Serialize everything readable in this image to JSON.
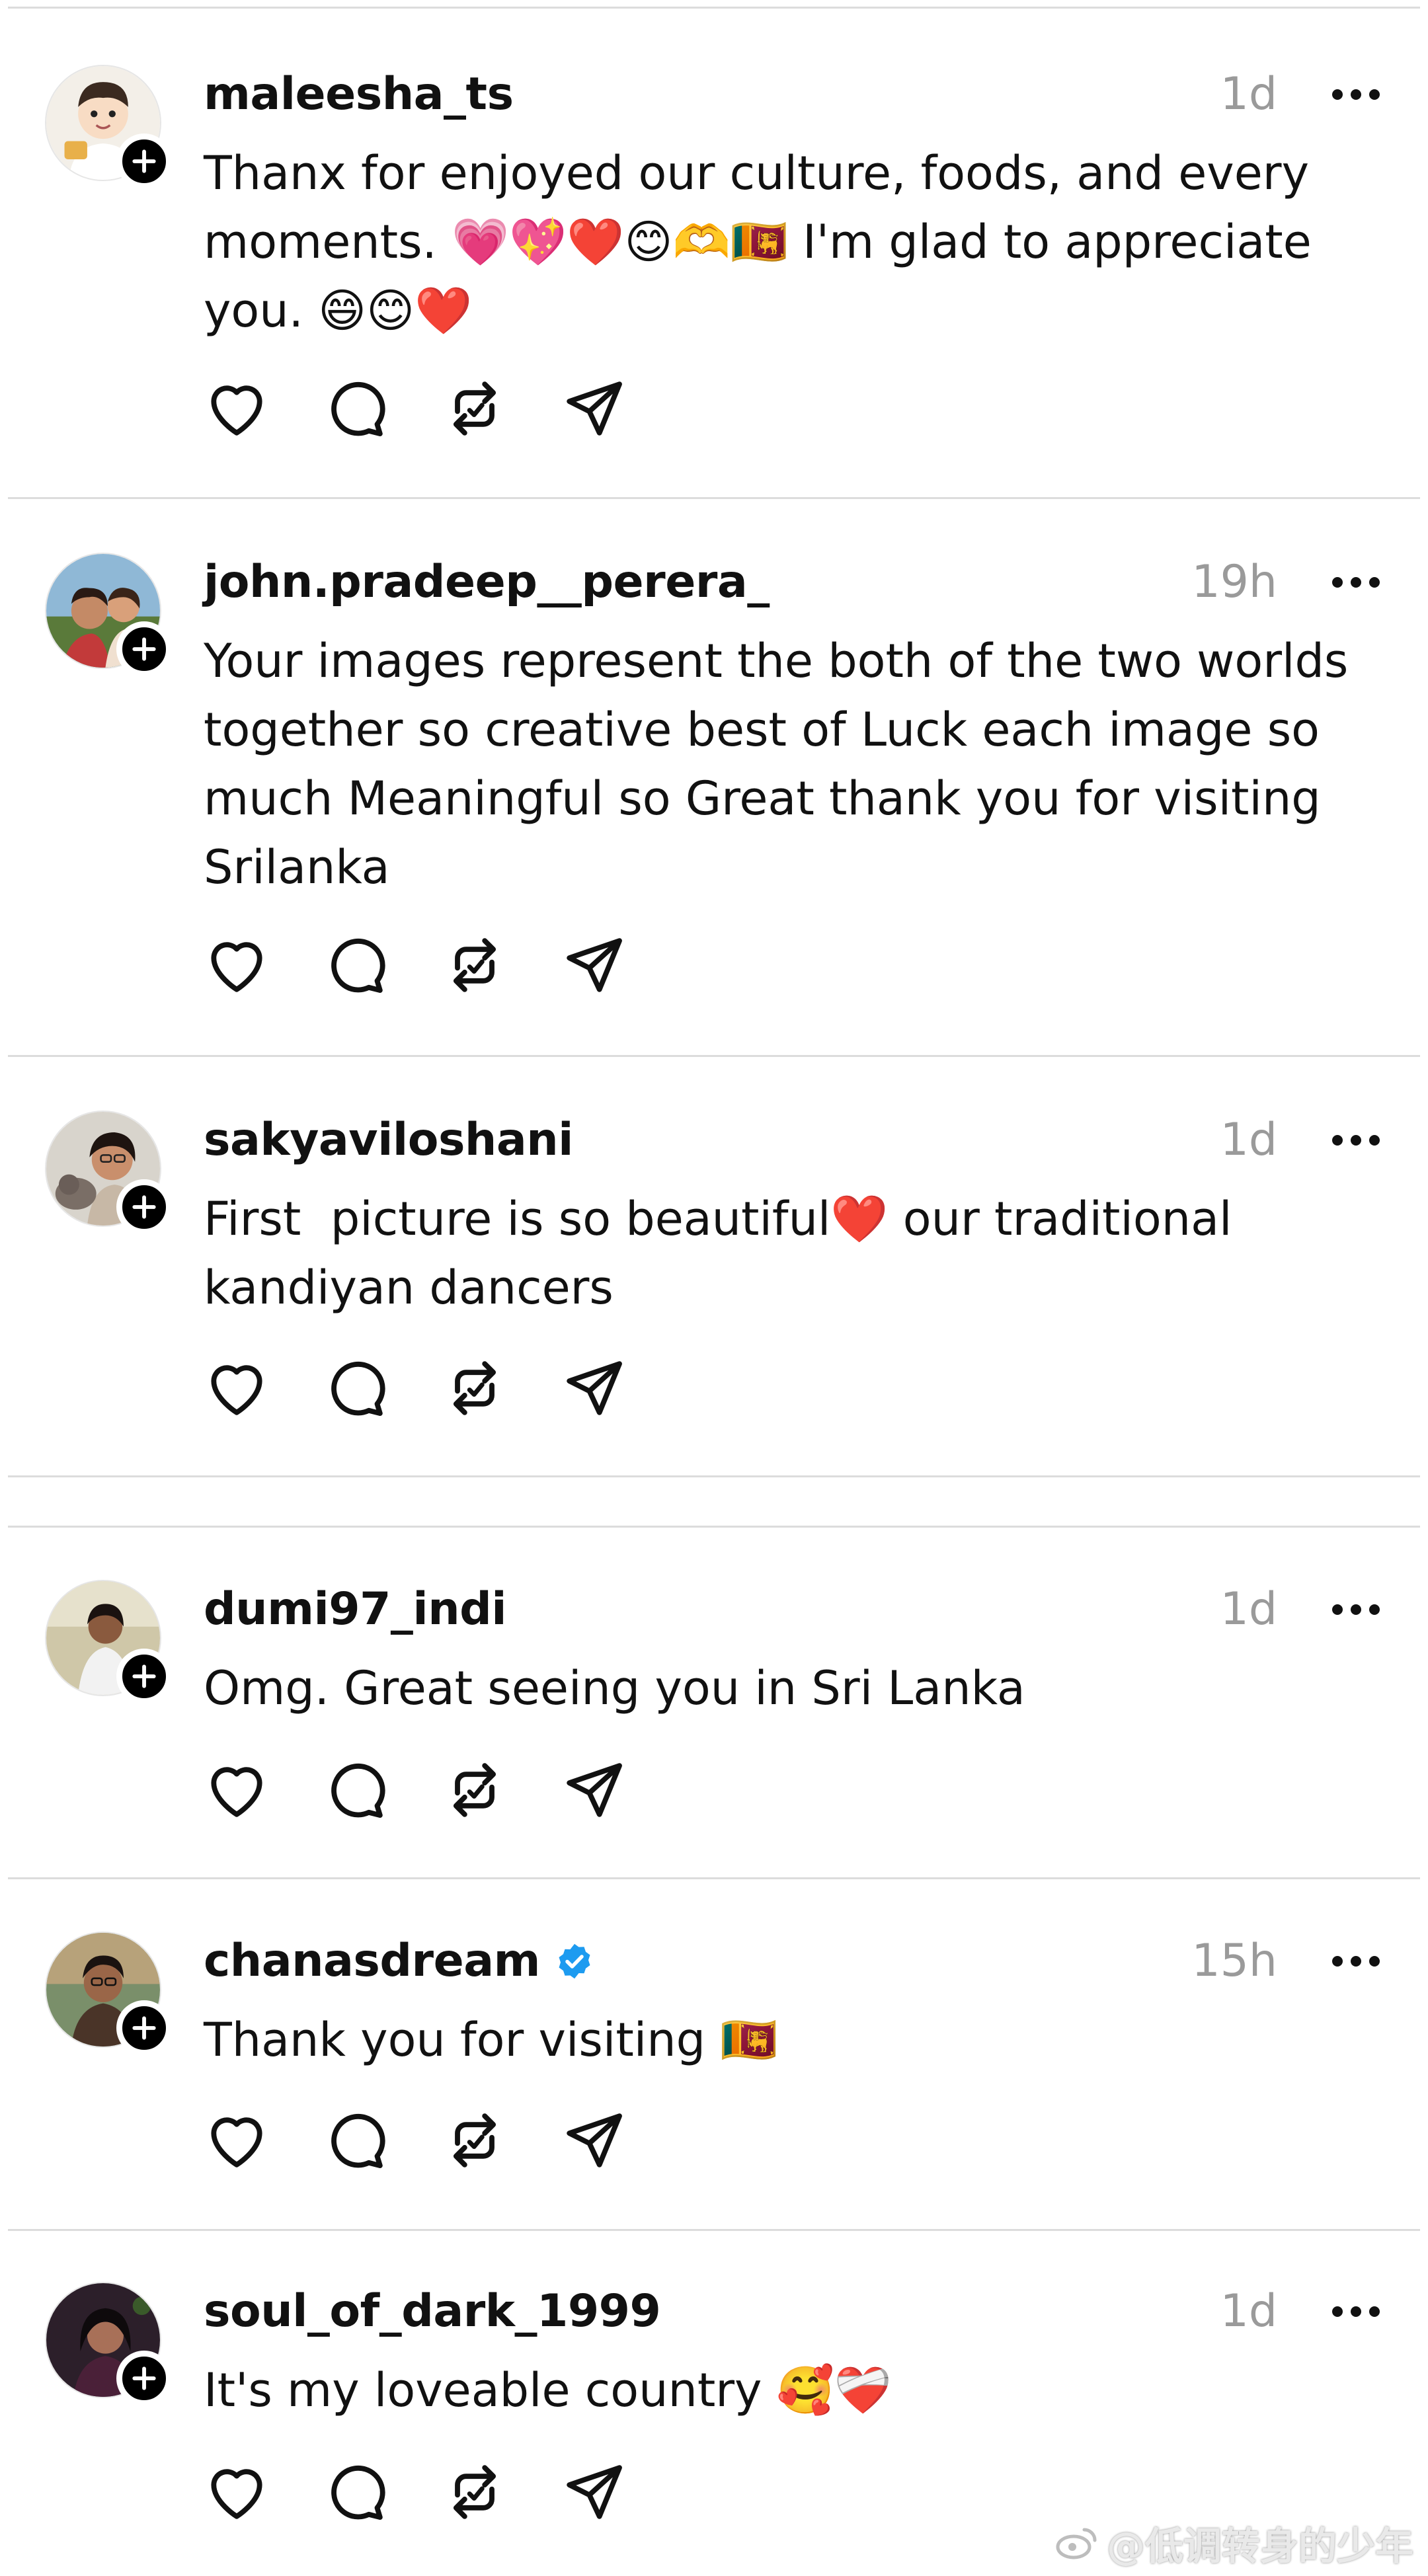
{
  "colors": {
    "text": "#111111",
    "muted": "#9a9a9a",
    "divider": "#dcdcdc",
    "verified": "#1d9bf0",
    "badge": "#000000"
  },
  "icons": [
    "heart-icon",
    "comment-icon",
    "repost-icon",
    "share-icon",
    "more-icon",
    "plus-icon",
    "verified-icon"
  ],
  "posts": [
    {
      "username": "maleesha_ts",
      "time": "1d",
      "verified": false,
      "text": "Thanx for enjoyed our culture, foods, and every\nmoments. 💗💖❤️😊🫶🇱🇰 I'm glad to appreciate\nyou. 😄😊❤️"
    },
    {
      "username": "john.pradeep__perera_",
      "time": "19h",
      "verified": false,
      "text": "Your images represent the both of the two worlds\ntogether so creative best of Luck each image so\nmuch Meaningful so Great thank you for visiting\nSrilanka"
    },
    {
      "username": "sakyaviloshani",
      "time": "1d",
      "verified": false,
      "text": "First  picture is so beautiful❤️ our traditional\nkandiyan dancers"
    },
    {
      "username": "dumi97_indi",
      "time": "1d",
      "verified": false,
      "text": "Omg. Great seeing you in Sri Lanka"
    },
    {
      "username": "chanasdream",
      "time": "15h",
      "verified": true,
      "text": "Thank you for visiting 🇱🇰"
    },
    {
      "username": "soul_of_dark_1999",
      "time": "1d",
      "verified": false,
      "text": "It's my loveable country 🥰❤️‍🩹"
    }
  ],
  "watermark": "@低调转身的少年"
}
